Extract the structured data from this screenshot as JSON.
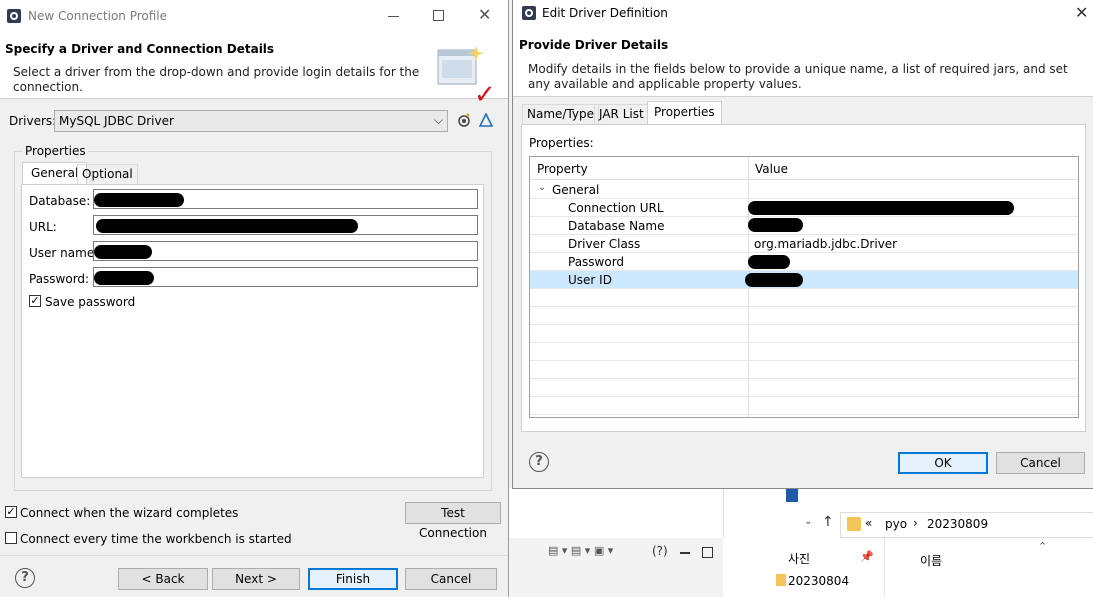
{
  "left_dialog": {
    "title": "New Connection Profile",
    "header_title": "Specify a Driver and Connection Details",
    "header_desc_line1": "Select a driver from the drop-down and provide login details for the",
    "header_desc_line2": "connection.",
    "drivers_label": "Drivers:",
    "driver_selected": "MySQL JDBC Driver",
    "properties_group": "Properties",
    "tabs": [
      "General",
      "Optional"
    ],
    "fields": {
      "database": "Database:",
      "url": "URL:",
      "user_name": "User name:",
      "password": "Password:"
    },
    "save_password": "Save password",
    "connect_when_complete": "Connect when the wizard completes",
    "connect_every_time": "Connect every time the workbench is started",
    "test_connection": "Test Connection",
    "back": "< Back",
    "next": "Next >",
    "finish": "Finish",
    "cancel": "Cancel",
    "help_symbol": "?"
  },
  "right_dialog": {
    "title": "Edit Driver Definition",
    "header_title": "Provide Driver Details",
    "header_desc_line1": "Modify details in the fields below to provide a unique name, a list of required jars, and set",
    "header_desc_line2": "any available and applicable property values.",
    "tabs": [
      "Name/Type",
      "JAR List",
      "Properties"
    ],
    "properties_label": "Properties:",
    "columns": [
      "Property",
      "Value"
    ],
    "group": "General",
    "rows": [
      {
        "property": "Connection URL",
        "value": ""
      },
      {
        "property": "Database Name",
        "value": ""
      },
      {
        "property": "Driver Class",
        "value": "org.mariadb.jdbc.Driver"
      },
      {
        "property": "Password",
        "value": ""
      },
      {
        "property": "User ID",
        "value": ""
      }
    ],
    "ok": "OK",
    "cancel": "Cancel",
    "help_symbol": "?"
  },
  "background": {
    "path_sep": "«",
    "path_1": "pyo",
    "path_arrow": "›",
    "path_2": "20230809",
    "nav_pics": "사진",
    "folder_item": "20230804",
    "column_name": "이름",
    "toolbar_question": "(?)"
  }
}
